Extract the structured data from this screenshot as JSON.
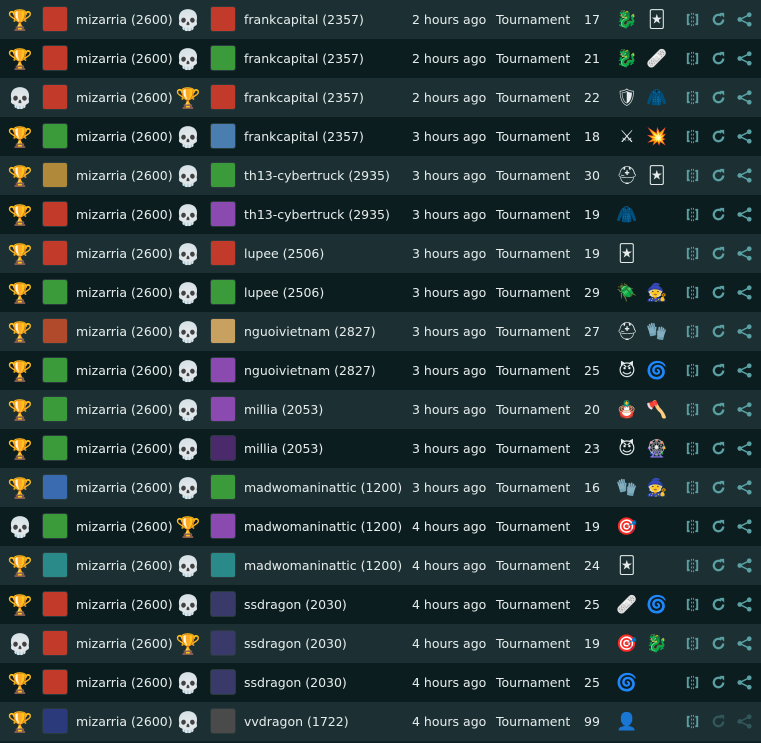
{
  "icons": {
    "win": "trophy-icon",
    "loss": "skull-icon",
    "view": "view-battle-icon",
    "replay": "replay-icon",
    "share": "share-icon"
  },
  "colors": {
    "row_even": "#1c3033",
    "row_odd": "#0c1d20",
    "text": "#e6ecec",
    "action": "#5aa0a3",
    "win_glyph": "#e8821e"
  },
  "battles": [
    {
      "result1": "win",
      "player1": "mizarria (2600)",
      "result2": "loss",
      "player2": "frankcapital (2357)",
      "time": "2 hours ago",
      "mode": "Tournament",
      "mana": "17",
      "ruleset_icons": [
        "red-dragon-icon",
        "cards-icon"
      ],
      "p1_avatar": "#c23a2a",
      "p2_avatar": "#c23a2a"
    },
    {
      "result1": "win",
      "player1": "mizarria (2600)",
      "result2": "loss",
      "player2": "frankcapital (2357)",
      "time": "2 hours ago",
      "mode": "Tournament",
      "mana": "21",
      "ruleset_icons": [
        "red-dragon-icon",
        "bandage-icon"
      ],
      "p1_avatar": "#c23a2a",
      "p2_avatar": "#3b9a3a"
    },
    {
      "result1": "loss",
      "player1": "mizarria (2600)",
      "result2": "win",
      "player2": "frankcapital (2357)",
      "time": "2 hours ago",
      "mode": "Tournament",
      "mana": "22",
      "ruleset_icons": [
        "shield-icon",
        "cloak-icon"
      ],
      "p1_avatar": "#c23a2a",
      "p2_avatar": "#c23a2a"
    },
    {
      "result1": "win",
      "player1": "mizarria (2600)",
      "result2": "loss",
      "player2": "frankcapital (2357)",
      "time": "3 hours ago",
      "mode": "Tournament",
      "mana": "18",
      "ruleset_icons": [
        "slash-icon",
        "explosion-icon"
      ],
      "p1_avatar": "#3b9a3a",
      "p2_avatar": "#4a7db0"
    },
    {
      "result1": "win",
      "player1": "mizarria (2600)",
      "result2": "loss",
      "player2": "th13-cybertruck (2935)",
      "time": "3 hours ago",
      "mode": "Tournament",
      "mana": "30",
      "ruleset_icons": [
        "viking-helmet-icon",
        "cards-icon"
      ],
      "p1_avatar": "#b08a3a",
      "p2_avatar": "#3b9a3a"
    },
    {
      "result1": "win",
      "player1": "mizarria (2600)",
      "result2": "loss",
      "player2": "th13-cybertruck (2935)",
      "time": "3 hours ago",
      "mode": "Tournament",
      "mana": "19",
      "ruleset_icons": [
        "cloak-icon"
      ],
      "p1_avatar": "#c23a2a",
      "p2_avatar": "#8a4ab0"
    },
    {
      "result1": "win",
      "player1": "mizarria (2600)",
      "result2": "loss",
      "player2": "lupee (2506)",
      "time": "3 hours ago",
      "mode": "Tournament",
      "mana": "19",
      "ruleset_icons": [
        "cards-icon"
      ],
      "p1_avatar": "#c23a2a",
      "p2_avatar": "#c23a2a"
    },
    {
      "result1": "win",
      "player1": "mizarria (2600)",
      "result2": "loss",
      "player2": "lupee (2506)",
      "time": "3 hours ago",
      "mode": "Tournament",
      "mana": "29",
      "ruleset_icons": [
        "beetle-icon",
        "hooded-figure-icon"
      ],
      "p1_avatar": "#3b9a3a",
      "p2_avatar": "#3b9a3a"
    },
    {
      "result1": "win",
      "player1": "mizarria (2600)",
      "result2": "loss",
      "player2": "nguoivietnam (2827)",
      "time": "3 hours ago",
      "mode": "Tournament",
      "mana": "27",
      "ruleset_icons": [
        "viking-helmet-icon",
        "gloves-icon"
      ],
      "p1_avatar": "#b04a2a",
      "p2_avatar": "#c8a060"
    },
    {
      "result1": "win",
      "player1": "mizarria (2600)",
      "result2": "loss",
      "player2": "nguoivietnam (2827)",
      "time": "3 hours ago",
      "mode": "Tournament",
      "mana": "25",
      "ruleset_icons": [
        "yellow-face-icon",
        "galaxy-icon"
      ],
      "p1_avatar": "#3b9a3a",
      "p2_avatar": "#8a4ab0"
    },
    {
      "result1": "win",
      "player1": "mizarria (2600)",
      "result2": "loss",
      "player2": "millia (2053)",
      "time": "3 hours ago",
      "mode": "Tournament",
      "mana": "20",
      "ruleset_icons": [
        "doll-icon",
        "axe-icon"
      ],
      "p1_avatar": "#3b9a3a",
      "p2_avatar": "#8a4ab0"
    },
    {
      "result1": "win",
      "player1": "mizarria (2600)",
      "result2": "loss",
      "player2": "millia (2053)",
      "time": "3 hours ago",
      "mode": "Tournament",
      "mana": "23",
      "ruleset_icons": [
        "yellow-face-icon",
        "color-wheel-icon"
      ],
      "p1_avatar": "#3b9a3a",
      "p2_avatar": "#4a2a6a"
    },
    {
      "result1": "win",
      "player1": "mizarria (2600)",
      "result2": "loss",
      "player2": "madwomaninattic (1200)",
      "time": "3 hours ago",
      "mode": "Tournament",
      "mana": "16",
      "ruleset_icons": [
        "gloves-icon",
        "hooded-figure-icon"
      ],
      "p1_avatar": "#3a6ab0",
      "p2_avatar": "#3b9a3a"
    },
    {
      "result1": "loss",
      "player1": "mizarria (2600)",
      "result2": "win",
      "player2": "madwomaninattic (1200)",
      "time": "4 hours ago",
      "mode": "Tournament",
      "mana": "19",
      "ruleset_icons": [
        "target-icon"
      ],
      "p1_avatar": "#3b9a3a",
      "p2_avatar": "#8a4ab0"
    },
    {
      "result1": "win",
      "player1": "mizarria (2600)",
      "result2": "loss",
      "player2": "madwomaninattic (1200)",
      "time": "4 hours ago",
      "mode": "Tournament",
      "mana": "24",
      "ruleset_icons": [
        "cards-icon"
      ],
      "p1_avatar": "#2a8a8a",
      "p2_avatar": "#2a8a8a"
    },
    {
      "result1": "win",
      "player1": "mizarria (2600)",
      "result2": "loss",
      "player2": "ssdragon (2030)",
      "time": "4 hours ago",
      "mode": "Tournament",
      "mana": "25",
      "ruleset_icons": [
        "bandage-icon",
        "galaxy-icon"
      ],
      "p1_avatar": "#c23a2a",
      "p2_avatar": "#3a3a6a"
    },
    {
      "result1": "loss",
      "player1": "mizarria (2600)",
      "result2": "win",
      "player2": "ssdragon (2030)",
      "time": "4 hours ago",
      "mode": "Tournament",
      "mana": "19",
      "ruleset_icons": [
        "target-icon",
        "red-dragon-icon"
      ],
      "p1_avatar": "#c23a2a",
      "p2_avatar": "#3a3a6a"
    },
    {
      "result1": "win",
      "player1": "mizarria (2600)",
      "result2": "loss",
      "player2": "ssdragon (2030)",
      "time": "4 hours ago",
      "mode": "Tournament",
      "mana": "25",
      "ruleset_icons": [
        "galaxy-icon"
      ],
      "p1_avatar": "#c23a2a",
      "p2_avatar": "#3a3a6a"
    },
    {
      "result1": "win",
      "player1": "mizarria (2600)",
      "result2": "loss",
      "player2": "vvdragon (1722)",
      "time": "4 hours ago",
      "mode": "Tournament",
      "mana": "99",
      "ruleset_icons": [
        "purple-hood-icon"
      ],
      "p1_avatar": "#2a3a7a",
      "p2_avatar": "#4a4a4a",
      "actions_disabled": true
    }
  ]
}
